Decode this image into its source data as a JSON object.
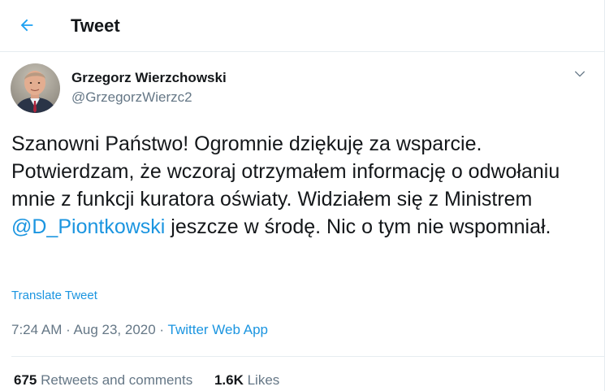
{
  "header": {
    "title": "Tweet"
  },
  "author": {
    "name": "Grzegorz Wierzchowski",
    "handle": "@GrzegorzWierzc2"
  },
  "tweet": {
    "text_part1": "Szanowni Państwo! Ogromnie dziękuję za wsparcie. Potwierdzam, że wczoraj otrzymałem informację o odwołaniu mnie z funkcji kuratora oświaty. Widziałem się z Ministrem ",
    "mention": "@D_Piontkowski",
    "text_part2": " jeszcze w środę. Nic o tym nie wspomniał.",
    "translate_label": "Translate Tweet"
  },
  "meta": {
    "time": "7:24 AM",
    "separator": " · ",
    "date": "Aug 23, 2020",
    "source": "Twitter Web App"
  },
  "stats": {
    "retweets_count": "675",
    "retweets_label": "Retweets and comments",
    "likes_count": "1.6K",
    "likes_label": "Likes"
  },
  "colors": {
    "accent": "#1b95e0",
    "text": "#14171a",
    "secondary": "#657786",
    "border": "#e6ecf0"
  },
  "icons": {
    "back": "arrow-left-icon",
    "caret": "chevron-down-icon"
  }
}
